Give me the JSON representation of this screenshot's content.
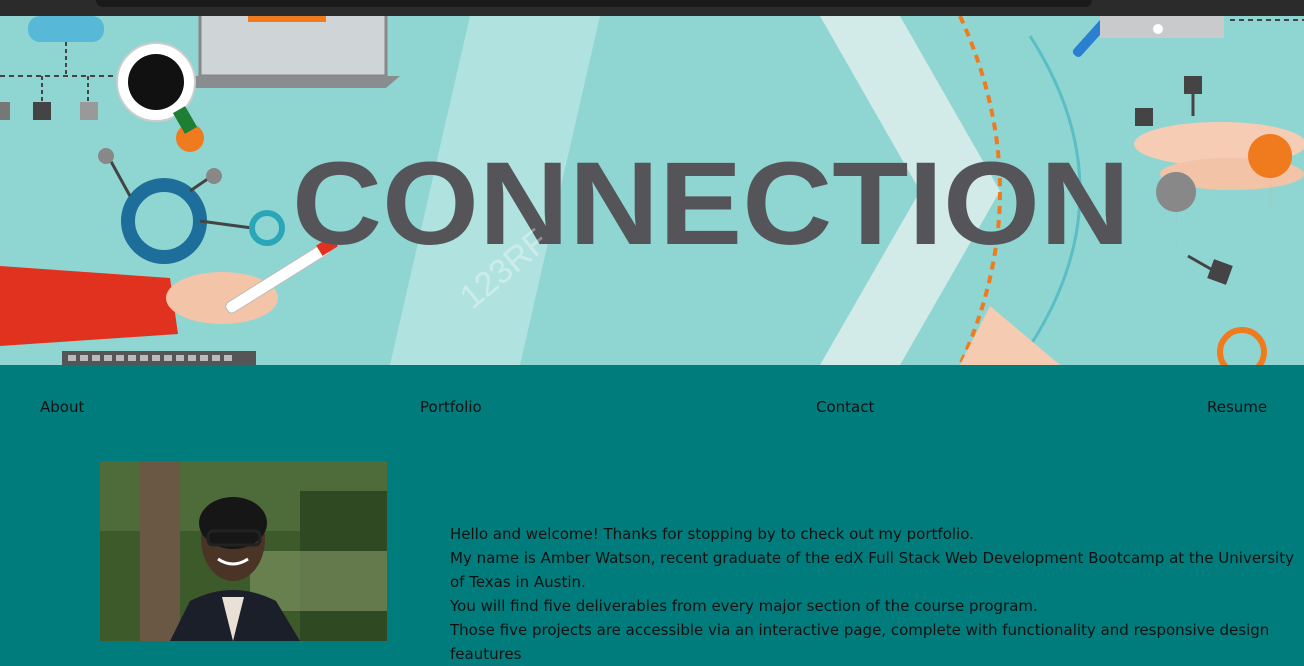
{
  "hero": {
    "headline": "CONNECTION",
    "watermark": "123RF"
  },
  "nav": {
    "about": "About",
    "portfolio": "Portfolio",
    "contact": "Contact",
    "resume": "Resume"
  },
  "intro": {
    "line1": "Hello and welcome! Thanks for stopping by to check out my portfolio.",
    "line2": "My name is Amber Watson, recent graduate of the edX Full Stack Web Development Bootcamp at the University of Texas in Austin.",
    "line3": "You will find five deliverables from every major section of the course program.",
    "line4": "Those five projects are accessible via an interactive page, complete with functionality and responsive design feautures"
  },
  "colors": {
    "page_bg": "#007c7c",
    "hero_bg": "#8fd6d2",
    "headline": "#555559",
    "accent_orange": "#f07a1e",
    "accent_red": "#e0321e"
  },
  "icons": [
    "coffee-cup-icon",
    "laptop-icon",
    "network-node-icon",
    "map-pin-icon",
    "hand-icon",
    "marker-icon"
  ]
}
